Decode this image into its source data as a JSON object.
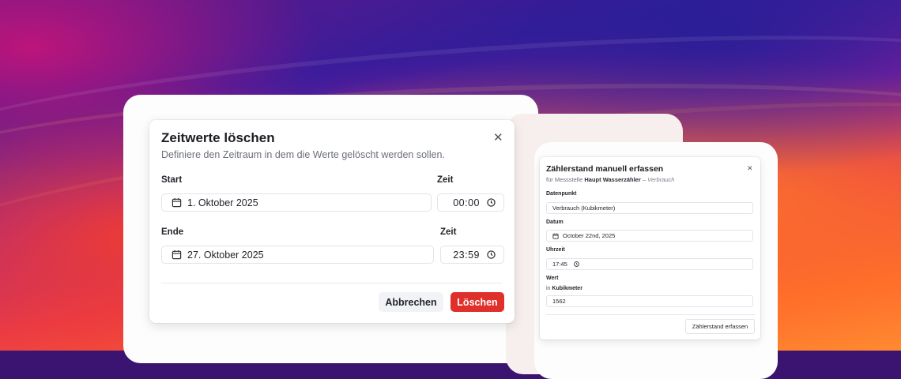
{
  "delete_dialog": {
    "title": "Zeitwerte löschen",
    "description": "Definiere den Zeitraum in dem die Werte gelöscht werden sollen.",
    "start_label": "Start",
    "start_time_label": "Zeit",
    "start_date": "1. Oktober 2025",
    "start_time": "00:00",
    "end_label": "Ende",
    "end_time_label": "Zeit",
    "end_date": "27. Oktober 2025",
    "end_time": "23:59",
    "cancel_label": "Abbrechen",
    "delete_label": "Löschen",
    "delete_color": "#e0302b"
  },
  "meter_dialog": {
    "title": "Zählerstand manuell erfassen",
    "subtitle_prefix": "für Messstelle",
    "subtitle_meter": "Haupt Wasserzähler",
    "subtitle_sep": "–",
    "subtitle_kind": "Verbrauch",
    "datapoint_label": "Datenpunkt",
    "datapoint_value": "Verbrauch (Kubikmeter)",
    "date_label": "Datum",
    "date_value": "October 22nd, 2025",
    "time_label": "Uhrzeit",
    "time_value": "17:45",
    "value_label": "Wert",
    "unit_prefix": "in",
    "unit": "Kubikmeter",
    "value": "1562",
    "submit_label": "Zählerstand erfassen"
  },
  "icons": [
    "calendar-icon",
    "clock-icon",
    "close-icon"
  ]
}
